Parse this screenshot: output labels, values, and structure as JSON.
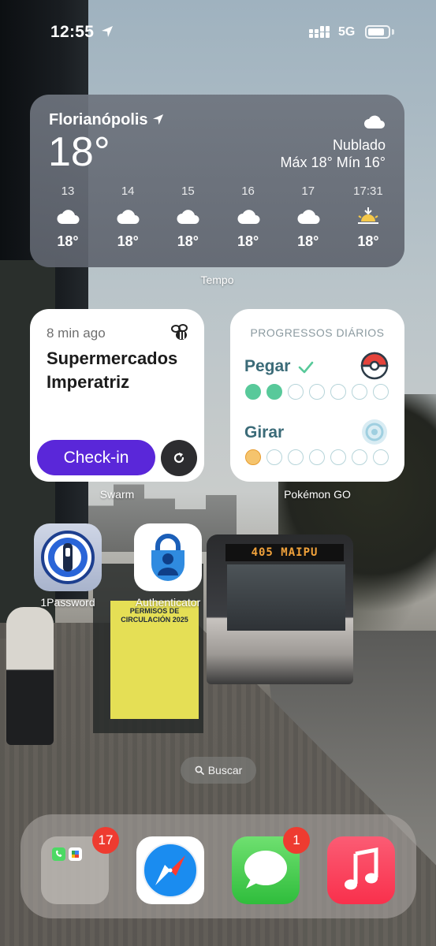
{
  "status_bar": {
    "time": "12:55",
    "network": "5G",
    "battery_level": 0.85
  },
  "weather_widget": {
    "city": "Florianópolis",
    "temperature": "18°",
    "condition": "Nublado",
    "high_low": "Máx 18° Mín 16°",
    "hourly": [
      {
        "label": "13",
        "icon": "cloud-icon",
        "temp": "18°"
      },
      {
        "label": "14",
        "icon": "cloud-icon",
        "temp": "18°"
      },
      {
        "label": "15",
        "icon": "cloud-icon",
        "temp": "18°"
      },
      {
        "label": "16",
        "icon": "cloud-icon",
        "temp": "18°"
      },
      {
        "label": "17",
        "icon": "cloud-icon",
        "temp": "18°"
      },
      {
        "label": "17:31",
        "icon": "sunset-icon",
        "temp": "18°"
      }
    ],
    "caption": "Tempo"
  },
  "swarm_widget": {
    "time_ago": "8 min ago",
    "place": "Supermercados Imperatriz",
    "checkin_label": "Check-in",
    "caption": "Swarm",
    "accent": "#5a27d9"
  },
  "pokemon_widget": {
    "title": "PROGRESSOS DIÁRIOS",
    "catch_label": "Pegar",
    "catch_progress": 2,
    "spin_label": "Girar",
    "spin_progress": 1,
    "total_days": 7,
    "caption": "Pokémon GO"
  },
  "apps": [
    {
      "label": "1Password",
      "icon": "1password-icon"
    },
    {
      "label": "Authenticator",
      "icon": "authenticator-icon"
    }
  ],
  "wallpaper": {
    "bus_sign": "405  MAIPU",
    "ad_text": "PERMISOS DE CIRCULACIÓN 2025"
  },
  "search": {
    "label": "Buscar"
  },
  "dock": {
    "folder_badge": "17",
    "messages_badge": "1",
    "items": [
      "folder-icon",
      "safari-icon",
      "messages-icon",
      "music-icon"
    ]
  }
}
